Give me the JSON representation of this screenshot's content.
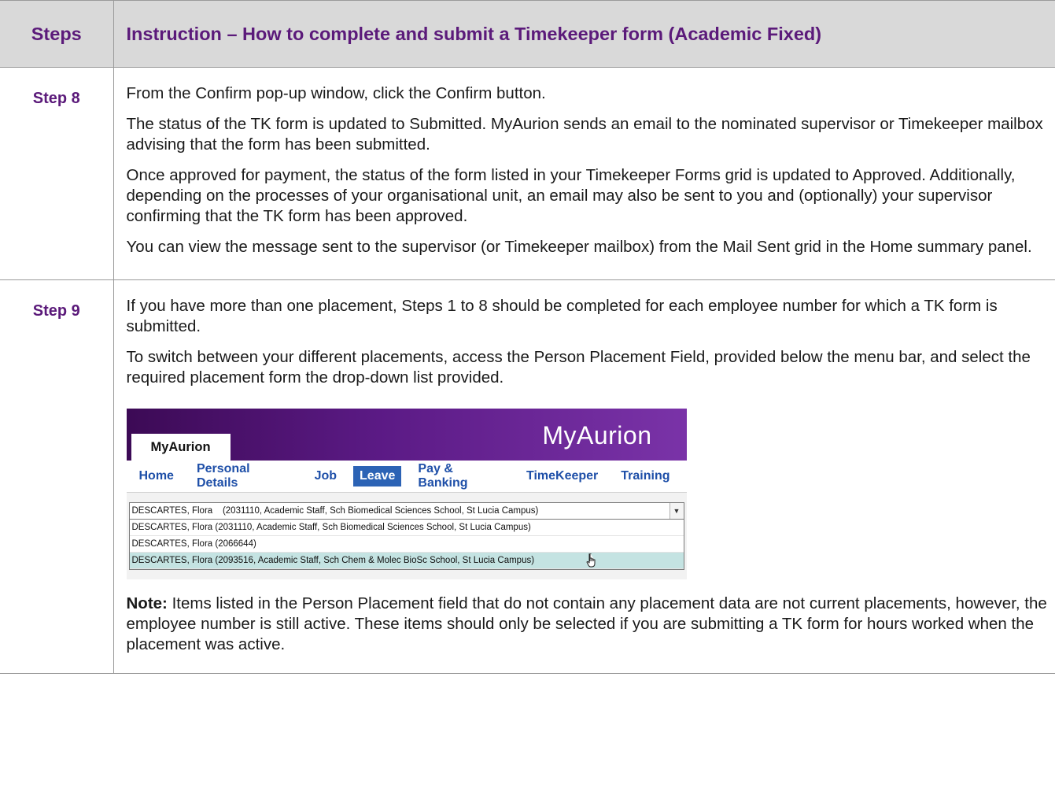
{
  "table": {
    "header": {
      "steps": "Steps",
      "instruction": "Instruction – How to complete and submit a Timekeeper form (Academic Fixed)"
    },
    "rows": [
      {
        "step": "Step 8",
        "paragraphs": [
          "From the Confirm pop-up window, click the Confirm button.",
          "The status of the TK form is updated to Submitted. MyAurion sends an email to the nominated supervisor or Timekeeper mailbox advising that the form has been submitted.",
          "Once approved for payment, the status of the form listed in your Timekeeper Forms grid is updated to Approved. Additionally, depending on the processes of your organisational unit, an email may also be sent to you and (optionally) your supervisor confirming that the TK form has been approved.",
          "You can view the message sent to the supervisor (or Timekeeper mailbox) from the Mail Sent grid in the Home summary panel."
        ]
      },
      {
        "step": "Step 9",
        "paragraphs": [
          "If you have more than one placement, Steps 1 to 8 should be completed for each employee number for which a TK form is submitted.",
          "To switch between your different placements, access the Person Placement Field, provided below the menu bar, and select the required placement form the drop-down list provided."
        ],
        "note_label": "Note:",
        "note_text": " Items listed in the Person Placement field that do not contain any placement data are not current placements, however, the employee number is still active. These items should only be selected if you are submitting a TK form for hours worked when the placement was active."
      }
    ]
  },
  "screenshot": {
    "brand": "MyAurion",
    "tab": "MyAurion",
    "nav": [
      "Home",
      "Personal Details",
      "Job",
      "Leave",
      "Pay & Banking",
      "TimeKeeper",
      "Training"
    ],
    "nav_active": "Leave",
    "select_value": "DESCARTES, Flora    (2031110, Academic Staff, Sch Biomedical Sciences School, St Lucia Campus)",
    "options": [
      "DESCARTES, Flora (2031110, Academic Staff, Sch Biomedical Sciences School, St Lucia Campus)",
      "DESCARTES, Flora (2066644)",
      "DESCARTES, Flora (2093516, Academic Staff, Sch Chem & Molec BioSc School, St Lucia Campus)"
    ],
    "hover_option_index": 2,
    "colors": {
      "banner_start": "#3c0a55",
      "banner_end": "#7a33a8",
      "nav_text": "#1e4fa8",
      "nav_active_bg": "#2c63b5",
      "hover_bg": "#c4e3e2",
      "heading_purple": "#5b1a7a"
    }
  }
}
